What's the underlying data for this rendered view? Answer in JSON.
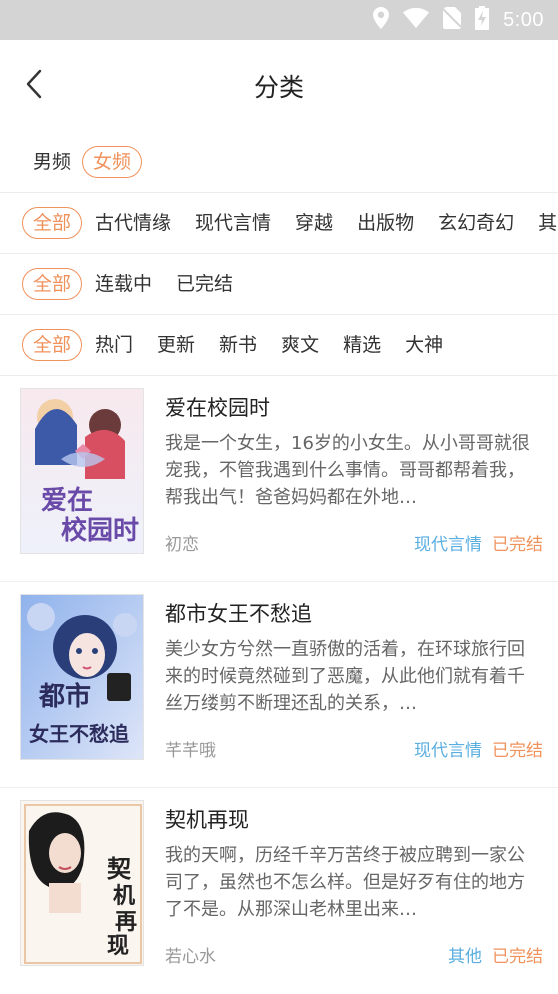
{
  "status_bar": {
    "time": "5:00"
  },
  "header": {
    "title": "分类"
  },
  "gender": [
    {
      "label": "男频",
      "active": false
    },
    {
      "label": "女频",
      "active": true
    }
  ],
  "categories": [
    {
      "label": "全部",
      "active": true
    },
    {
      "label": "古代情缘",
      "active": false
    },
    {
      "label": "现代言情",
      "active": false
    },
    {
      "label": "穿越",
      "active": false
    },
    {
      "label": "出版物",
      "active": false
    },
    {
      "label": "玄幻奇幻",
      "active": false
    },
    {
      "label": "其",
      "active": false
    }
  ],
  "progress": [
    {
      "label": "全部",
      "active": true
    },
    {
      "label": "连载中",
      "active": false
    },
    {
      "label": "已完结",
      "active": false
    }
  ],
  "sort": [
    {
      "label": "全部",
      "active": true
    },
    {
      "label": "热门",
      "active": false
    },
    {
      "label": "更新",
      "active": false
    },
    {
      "label": "新书",
      "active": false
    },
    {
      "label": "爽文",
      "active": false
    },
    {
      "label": "精选",
      "active": false
    },
    {
      "label": "大神",
      "active": false
    }
  ],
  "books": [
    {
      "title": "爱在校园时",
      "desc": "我是一个女生，16岁的小女生。从小哥哥就很宠我，不管我遇到什么事情。哥哥都帮着我，帮我出气！爸爸妈妈都在外地…",
      "author": "初恋",
      "genre": "现代言情",
      "status": "已完结",
      "cover_text": [
        "爱在",
        "校园时"
      ]
    },
    {
      "title": "都市女王不愁追",
      "desc": "美少女方兮然一直骄傲的活着，在环球旅行回来的时候竟然碰到了恶魔，从此他们就有着千丝万缕剪不断理还乱的关系，…",
      "author": "芊芊哦",
      "genre": "现代言情",
      "status": "已完结",
      "cover_text": [
        "都市",
        "女王不愁追"
      ]
    },
    {
      "title": "契机再现",
      "desc": "我的天啊，历经千辛万苦终于被应聘到一家公司了，虽然也不怎么样。但是好歹有住的地方了不是。从那深山老林里出来…",
      "author": "若心水",
      "genre": "其他",
      "status": "已完结",
      "cover_text": [
        "契",
        "机",
        "再",
        "现"
      ]
    }
  ]
}
